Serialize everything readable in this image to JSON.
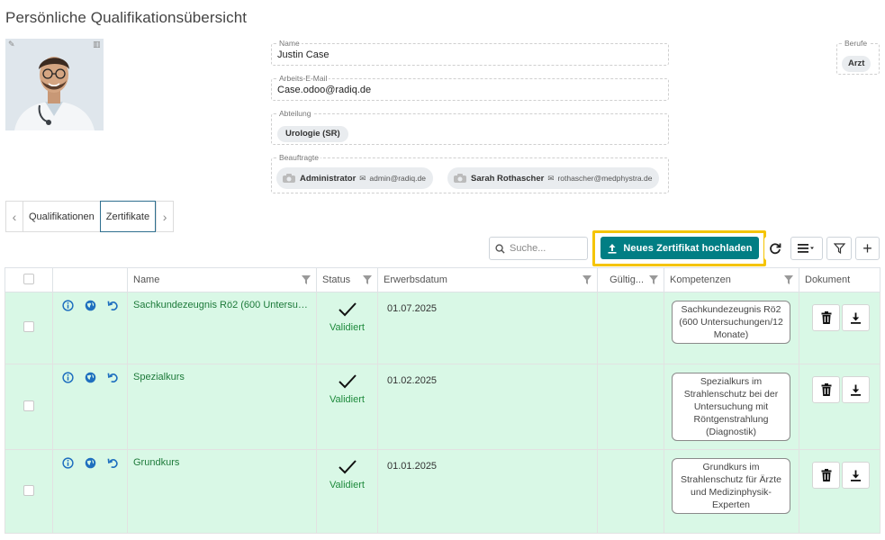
{
  "page": {
    "title": "Persönliche Qualifikationsübersicht"
  },
  "employee": {
    "name_label": "Name",
    "name": "Justin Case",
    "email_label": "Arbeits-E-Mail",
    "email": "Case.odoo@radiq.de",
    "department_label": "Abteilung",
    "department": "Urologie (SR)",
    "officers_label": "Beauftragte",
    "officers": [
      {
        "name": "Administrator",
        "email": "admin@radiq.de"
      },
      {
        "name": "Sarah Rothascher",
        "email": "rothascher@medphystra.de"
      }
    ],
    "professions_label": "Berufe",
    "professions": [
      "Arzt"
    ]
  },
  "tabs": [
    {
      "label": "Qualifikationen",
      "active": false
    },
    {
      "label": "Zertifikate",
      "active": true
    }
  ],
  "toolbar": {
    "search_placeholder": "Suche...",
    "upload_label": "Neues Zertifikat hochladen"
  },
  "table": {
    "columns": [
      "",
      "",
      "Name",
      "Status",
      "Erwerbsdatum",
      "Gültig...",
      "Kompetenzen",
      "Dokument"
    ],
    "rows": [
      {
        "name": "Sachkundezeugnis Rö2 (600 Untersuchu...",
        "status": "Validiert",
        "date": "01.07.2025",
        "valid": "",
        "competence": "Sachkundezeugnis Rö2 (600 Untersuchungen/12 Monate)"
      },
      {
        "name": "Spezialkurs",
        "status": "Validiert",
        "date": "01.02.2025",
        "valid": "",
        "competence": "Spezialkurs im Strahlenschutz bei der Untersuchung mit Röntgenstrahlung (Diagnostik)"
      },
      {
        "name": "Grundkurs",
        "status": "Validiert",
        "date": "01.01.2025",
        "valid": "",
        "competence": "Grundkurs im Strahlenschutz für Ärzte und Medizinphysik-Experten"
      }
    ]
  },
  "colors": {
    "primary": "#017e84",
    "highlight": "#f5c400",
    "row_bg": "#d9f8e6",
    "link_green": "#1d7a3a",
    "icon_blue": "#1f6fbf"
  },
  "icons": {
    "row": [
      "info-icon",
      "globe-icon",
      "undo-icon"
    ],
    "doc": [
      "trash-icon",
      "download-icon"
    ],
    "toolbar": [
      "search-icon",
      "upload-icon",
      "refresh-icon",
      "list-menu-icon",
      "filter-icon",
      "plus-icon"
    ]
  }
}
